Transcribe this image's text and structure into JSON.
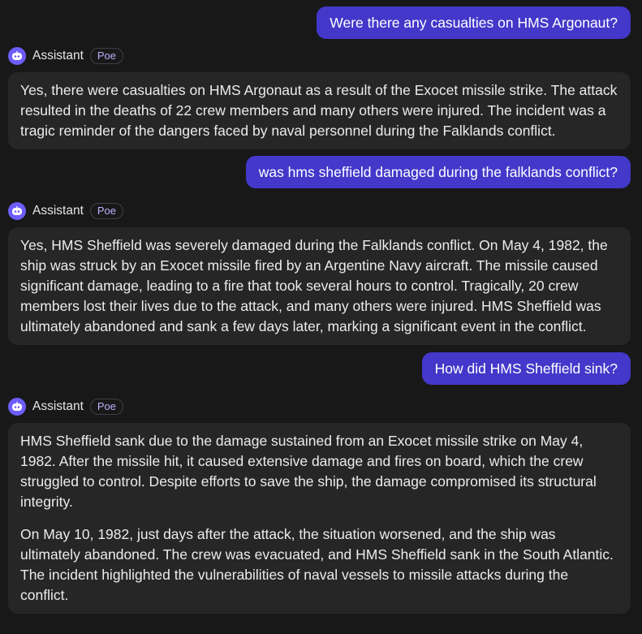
{
  "assistant": {
    "name": "Assistant",
    "badge": "Poe",
    "avatar_icon": "robot-icon",
    "avatar_color": "#6d5dfc"
  },
  "colors": {
    "background": "#181818",
    "user_bubble": "#4338ca",
    "bot_bubble": "#262626"
  },
  "messages": [
    {
      "role": "user",
      "text": "Were there any casualties on HMS Argonaut?"
    },
    {
      "role": "assistant",
      "paragraphs": [
        "Yes, there were casualties on HMS Argonaut as a result of the Exocet missile strike. The attack resulted in the deaths of 22 crew members and many others were injured. The incident was a tragic reminder of the dangers faced by naval personnel during the Falklands conflict."
      ]
    },
    {
      "role": "user",
      "text": "was hms sheffield damaged during the falklands conflict?"
    },
    {
      "role": "assistant",
      "paragraphs": [
        "Yes, HMS Sheffield was severely damaged during the Falklands conflict. On May 4, 1982, the ship was struck by an Exocet missile fired by an Argentine Navy aircraft. The missile caused significant damage, leading to a fire that took several hours to control. Tragically, 20 crew members lost their lives due to the attack, and many others were injured. HMS Sheffield was ultimately abandoned and sank a few days later, marking a significant event in the conflict."
      ]
    },
    {
      "role": "user",
      "text": "How did HMS Sheffield sink?"
    },
    {
      "role": "assistant",
      "paragraphs": [
        "HMS Sheffield sank due to the damage sustained from an Exocet missile strike on May 4, 1982. After the missile hit, it caused extensive damage and fires on board, which the crew struggled to control. Despite efforts to save the ship, the damage compromised its structural integrity.",
        "On May 10, 1982, just days after the attack, the situation worsened, and the ship was ultimately abandoned. The crew was evacuated, and HMS Sheffield sank in the South Atlantic. The incident highlighted the vulnerabilities of naval vessels to missile attacks during the conflict."
      ]
    }
  ]
}
